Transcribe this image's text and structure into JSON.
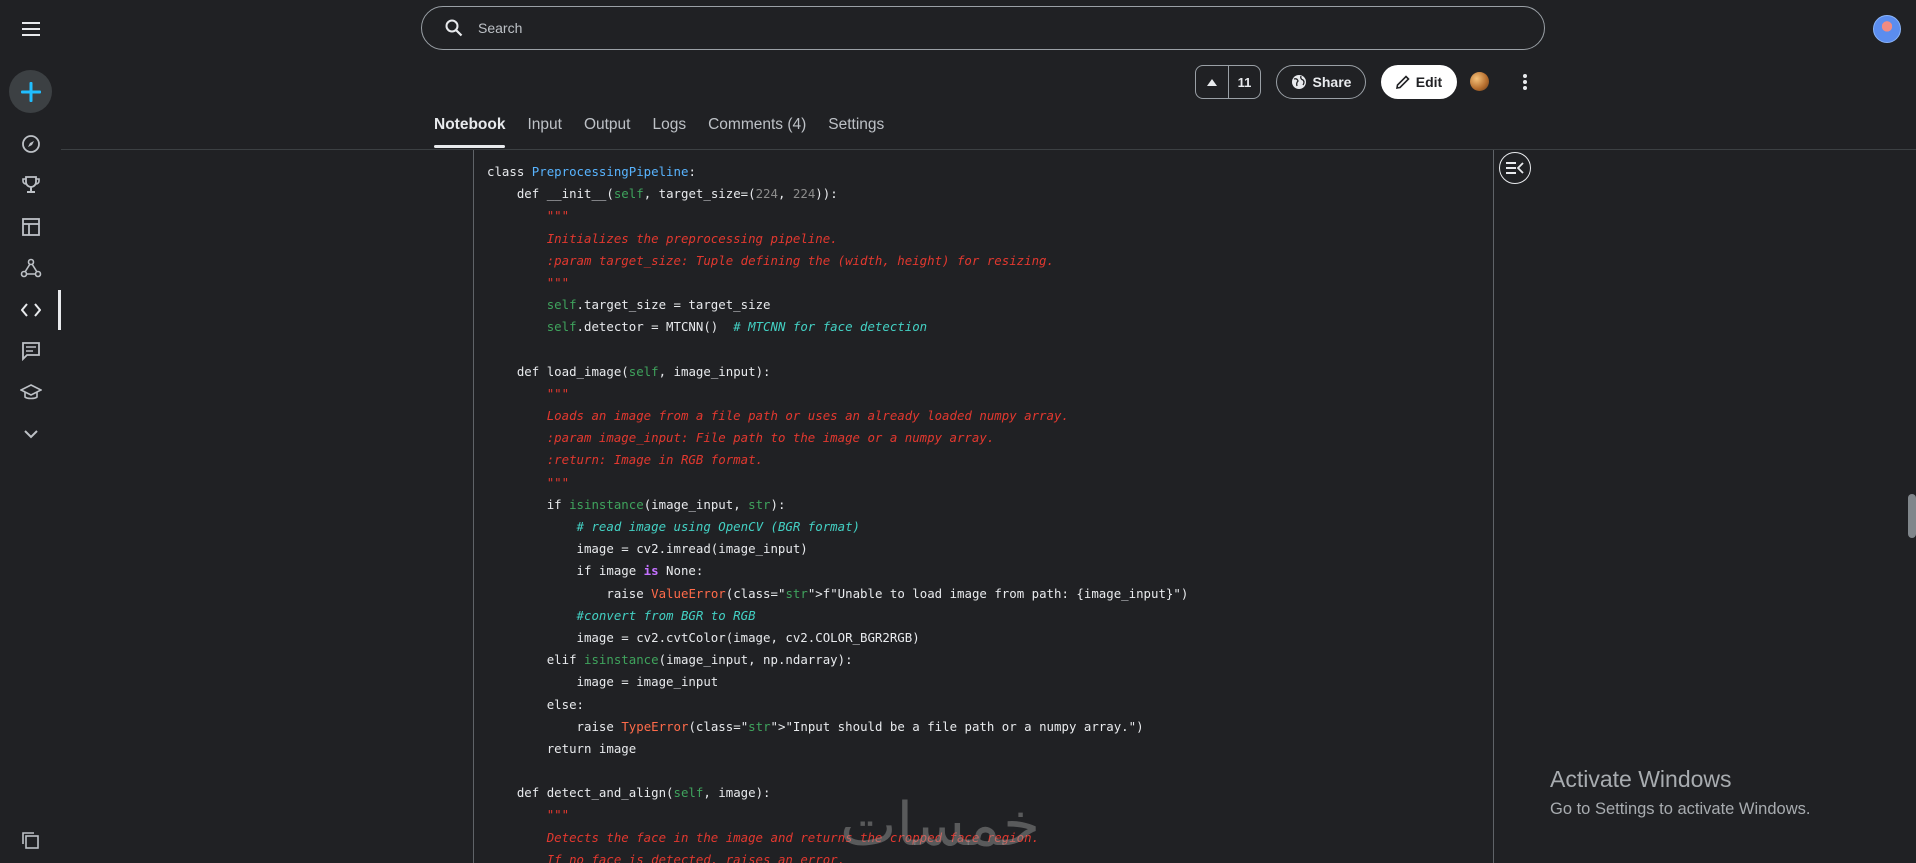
{
  "search": {
    "placeholder": "Search"
  },
  "actions": {
    "vote_count": "11",
    "share_label": "Share",
    "edit_label": "Edit"
  },
  "tabs": [
    {
      "label": "Notebook",
      "active": true
    },
    {
      "label": "Input"
    },
    {
      "label": "Output"
    },
    {
      "label": "Logs"
    },
    {
      "label": "Comments (4)"
    },
    {
      "label": "Settings"
    }
  ],
  "sidebar": {
    "items": [
      "menu-icon",
      "create-icon",
      "compass-icon",
      "trophy-icon",
      "table-icon",
      "model-icon",
      "code-icon",
      "comments-icon",
      "school-icon",
      "chevron-down-icon"
    ],
    "bottom": "copy-icon"
  },
  "code_lines": [
    "class PreprocessingPipeline:",
    "    def __init__(self, target_size=(224, 224)):",
    "        \"\"\"",
    "        Initializes the preprocessing pipeline.",
    "        :param target_size: Tuple defining the (width, height) for resizing.",
    "        \"\"\"",
    "        self.target_size = target_size",
    "        self.detector = MTCNN()  # MTCNN for face detection",
    "",
    "    def load_image(self, image_input):",
    "        \"\"\"",
    "        Loads an image from a file path or uses an already loaded numpy array.",
    "        :param image_input: File path to the image or a numpy array.",
    "        :return: Image in RGB format.",
    "        \"\"\"",
    "        if isinstance(image_input, str):",
    "            # read image using OpenCV (BGR format)",
    "            image = cv2.imread(image_input)",
    "            if image is None:",
    "                raise ValueError(f\"Unable to load image from path: {image_input}\")",
    "            #convert from BGR to RGB",
    "            image = cv2.cvtColor(image, cv2.COLOR_BGR2RGB)",
    "        elif isinstance(image_input, np.ndarray):",
    "            image = image_input",
    "        else:",
    "            raise TypeError(\"Input should be a file path or a numpy array.\")",
    "        return image",
    "",
    "    def detect_and_align(self, image):",
    "        \"\"\"",
    "        Detects the face in the image and returns the cropped face region.",
    "        If no face is detected, raises an error."
  ],
  "overlay": {
    "activate_title": "Activate Windows",
    "activate_sub": "Go to Settings to activate Windows.",
    "watermark": "خمسات"
  },
  "colors": {
    "background": "#202124",
    "accent": "#20beff",
    "docstring": "#e2382f",
    "comment": "#43d0c3",
    "class_name": "#58b4ff"
  }
}
